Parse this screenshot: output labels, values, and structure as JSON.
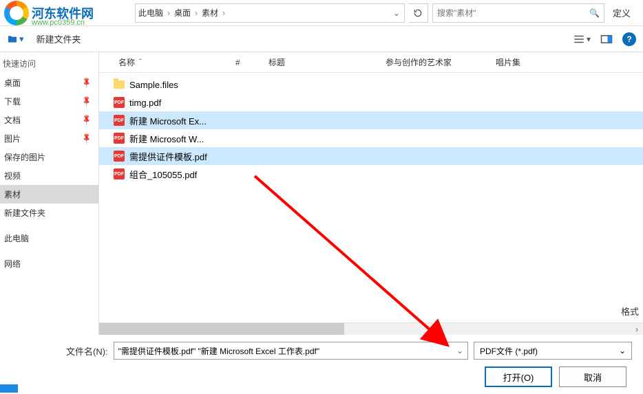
{
  "logo": {
    "text": "河东软件网",
    "url": "www.pc0359.cn"
  },
  "breadcrumbs": [
    "此电脑",
    "桌面",
    "素材"
  ],
  "search": {
    "placeholder": "搜索\"素材\""
  },
  "right_panel_label": "定义",
  "toolbar": {
    "new_folder": "新建文件夹"
  },
  "sidebar": {
    "quick_access": "快速访问",
    "items": [
      {
        "label": "桌面",
        "pinned": true
      },
      {
        "label": "下载",
        "pinned": true
      },
      {
        "label": "文档",
        "pinned": true
      },
      {
        "label": "图片",
        "pinned": true
      },
      {
        "label": "保存的图片",
        "pinned": false
      },
      {
        "label": "视频",
        "pinned": false
      },
      {
        "label": "素材",
        "pinned": false,
        "selected": true
      },
      {
        "label": "新建文件夹",
        "pinned": false
      }
    ],
    "this_pc": "此电脑",
    "network": "网络"
  },
  "columns": {
    "name": "名称",
    "num": "#",
    "title": "标题",
    "artist": "参与创作的艺术家",
    "album": "唱片集"
  },
  "files": [
    {
      "icon": "folder",
      "name": "Sample.files",
      "selected": false
    },
    {
      "icon": "pdf",
      "name": "timg.pdf",
      "selected": false
    },
    {
      "icon": "pdf",
      "name": "新建 Microsoft Ex...",
      "selected": true
    },
    {
      "icon": "pdf",
      "name": "新建 Microsoft W...",
      "selected": false
    },
    {
      "icon": "pdf",
      "name": "需提供证件模板.pdf",
      "selected": true
    },
    {
      "icon": "pdf",
      "name": "组合_105055.pdf",
      "selected": false
    }
  ],
  "filename": {
    "label": "文件名(N):",
    "value": "\"需提供证件模板.pdf\" \"新建 Microsoft Excel 工作表.pdf\"",
    "type": "PDF文件 (*.pdf)"
  },
  "buttons": {
    "open": "打开(O)",
    "cancel": "取消"
  },
  "right_format_label": "格式"
}
